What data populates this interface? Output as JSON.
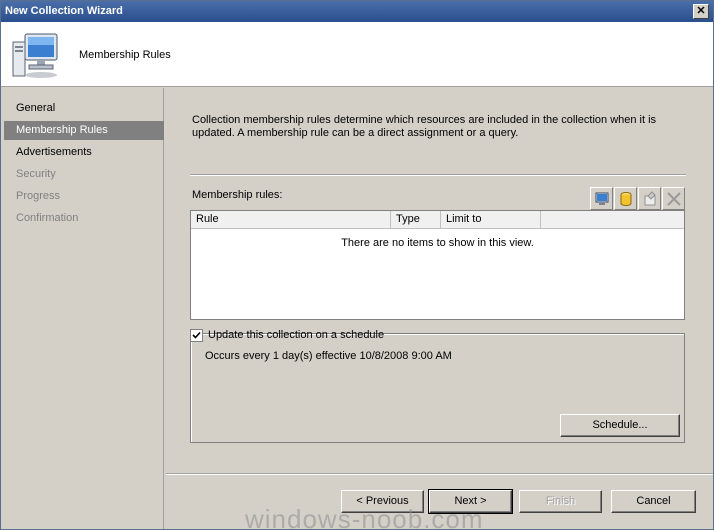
{
  "window": {
    "title": "New Collection Wizard",
    "close_label": "✕"
  },
  "header": {
    "heading": "Membership Rules",
    "icon": "computer-icon"
  },
  "nav": {
    "items": [
      {
        "label": "General",
        "state": "normal"
      },
      {
        "label": "Membership Rules",
        "state": "selected"
      },
      {
        "label": "Advertisements",
        "state": "normal"
      },
      {
        "label": "Security",
        "state": "disabled"
      },
      {
        "label": "Progress",
        "state": "disabled"
      },
      {
        "label": "Confirmation",
        "state": "disabled"
      }
    ]
  },
  "main": {
    "description": "Collection membership rules determine which resources are included in the collection when it is updated. A membership rule can be a direct assignment or a query.",
    "rules_label": "Membership rules:",
    "toolbar": [
      "new-direct-rule-icon",
      "new-query-rule-icon",
      "properties-icon",
      "delete-icon"
    ],
    "columns": [
      "Rule",
      "Type",
      "Limit to"
    ],
    "empty_message": "There are no items to show in this view.",
    "schedule": {
      "checkbox_label": "Update this collection on a schedule",
      "checked": true,
      "occurs": "Occurs every 1 day(s) effective 10/8/2008 9:00 AM",
      "schedule_button": "Schedule..."
    }
  },
  "footer": {
    "previous": "< Previous",
    "next": "Next >",
    "finish": "Finish",
    "cancel": "Cancel"
  },
  "watermark": "windows-noob.com"
}
